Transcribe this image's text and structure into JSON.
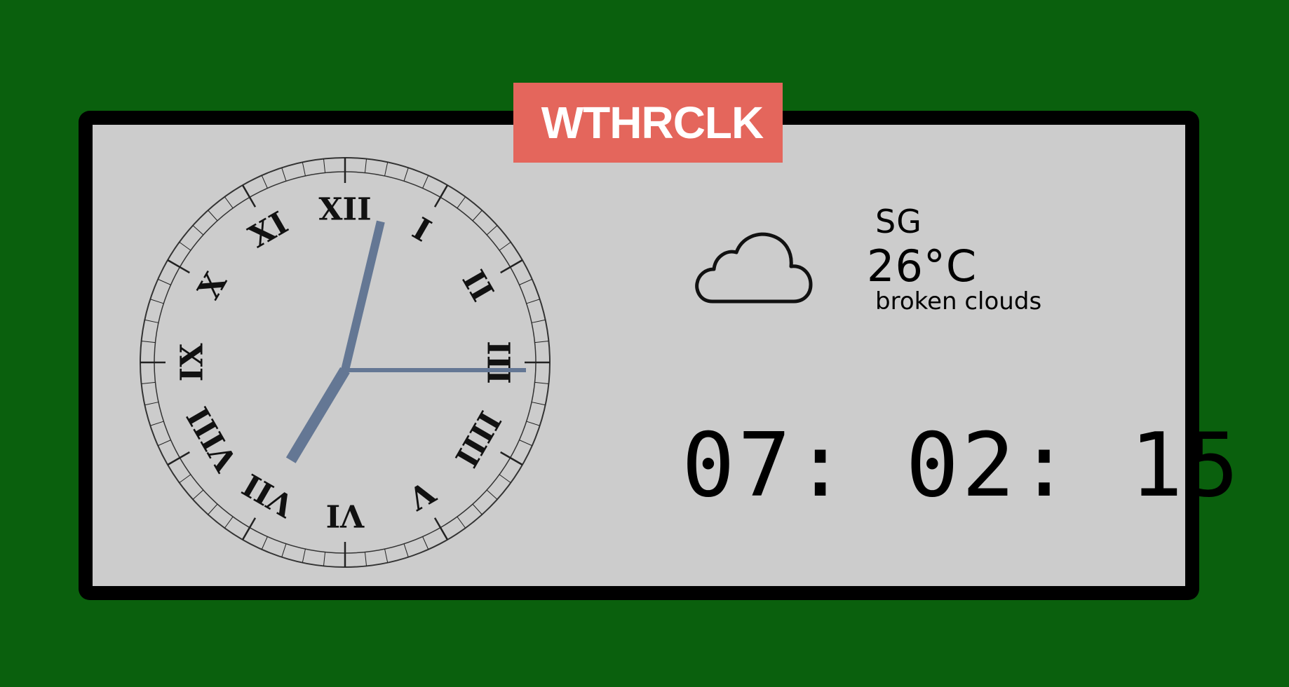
{
  "app": {
    "title": "WTHRCLK",
    "title_bg_color": "#e4665c",
    "background_color": "#0a600d",
    "panel_color": "#cccccc"
  },
  "analog_clock": {
    "numerals": [
      "XII",
      "I",
      "II",
      "III",
      "IIII",
      "V",
      "VI",
      "VII",
      "VIII",
      "IX",
      "X",
      "XI"
    ],
    "hour": 7,
    "minute": 2,
    "second": 15,
    "hand_color": "#647794"
  },
  "weather": {
    "icon": "cloud-icon",
    "city": "SG",
    "temperature": "26°C",
    "description": "broken clouds"
  },
  "digital_clock": {
    "time": "07: 02: 15"
  }
}
